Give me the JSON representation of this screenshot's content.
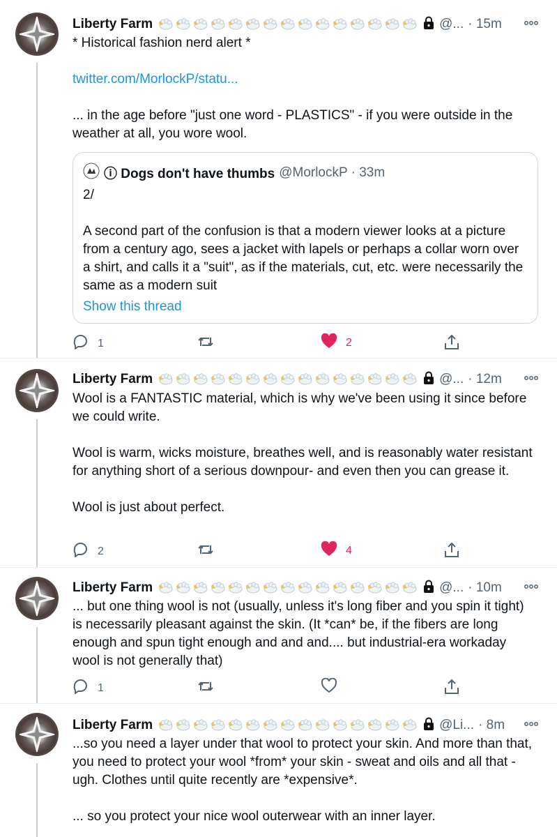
{
  "tweets": [
    {
      "name": "Liberty Farm",
      "handle": "@...",
      "time": "· 15m",
      "paragraphs": [
        "* Historical fashion nerd alert *"
      ],
      "link": "twitter.com/MorlockP/statu...",
      "paragraphs_after": [
        "... in the age before \"just one word - PLASTICS\" - if you were outside in the weather at all, you wore wool."
      ],
      "quote": {
        "name": "ⓘ Dogs don't have thumbs",
        "handle": "@MorlockP · 33m",
        "lines": [
          "2/",
          "",
          "A second part of the confusion is that a modern viewer looks at a picture from a century ago, sees a jacket with lapels  or perhaps a collar worn over a shirt, and calls it a \"suit\", as if the materials, cut, etc. were necessarily the same as a modern suit"
        ],
        "show_thread": "Show this thread"
      },
      "replies": "1",
      "likes": "2",
      "liked": true
    },
    {
      "name": "Liberty Farm",
      "handle": "@...",
      "time": "· 12m",
      "paragraphs": [
        "Wool is a FANTASTIC material, which is why we've been using it since before we could write.",
        "Wool is warm, wicks moisture, breathes well, and is reasonably water resistant for anything short of a serious downpour- and even then you can grease it.",
        "Wool is just about perfect."
      ],
      "replies": "2",
      "likes": "4",
      "liked": true
    },
    {
      "name": "Liberty Farm",
      "handle": "@...",
      "time": "· 10m",
      "paragraphs": [
        "... but one thing wool is not (usually, unless it's long fiber and you spin it tight) is necessarily pleasant against the skin. (It *can* be, if the fibers are long enough and spun tight enough and and and.... but industrial-era workaday wool is not generally that)"
      ],
      "replies": "1",
      "likes": "",
      "liked": false
    },
    {
      "name": "Liberty Farm",
      "handle": "@Li...",
      "time": "· 8m",
      "paragraphs": [
        "...so you need a layer under that wool to protect your skin. And more than that, you need to protect your wool *from* your skin - sweat and oils and all that - ugh. Clothes until quite recently are *expensive*.",
        "... so you protect your nice wool outerwear with an inner layer."
      ]
    }
  ],
  "colors": {
    "accent": "#1b95e0",
    "like": "#e0245e",
    "muted": "#536471",
    "border": "#cfd9de"
  },
  "icons": [
    "sheep-emoji-icon",
    "lock-icon",
    "more-icon",
    "reply-icon",
    "retweet-icon",
    "heart-icon",
    "share-icon"
  ]
}
